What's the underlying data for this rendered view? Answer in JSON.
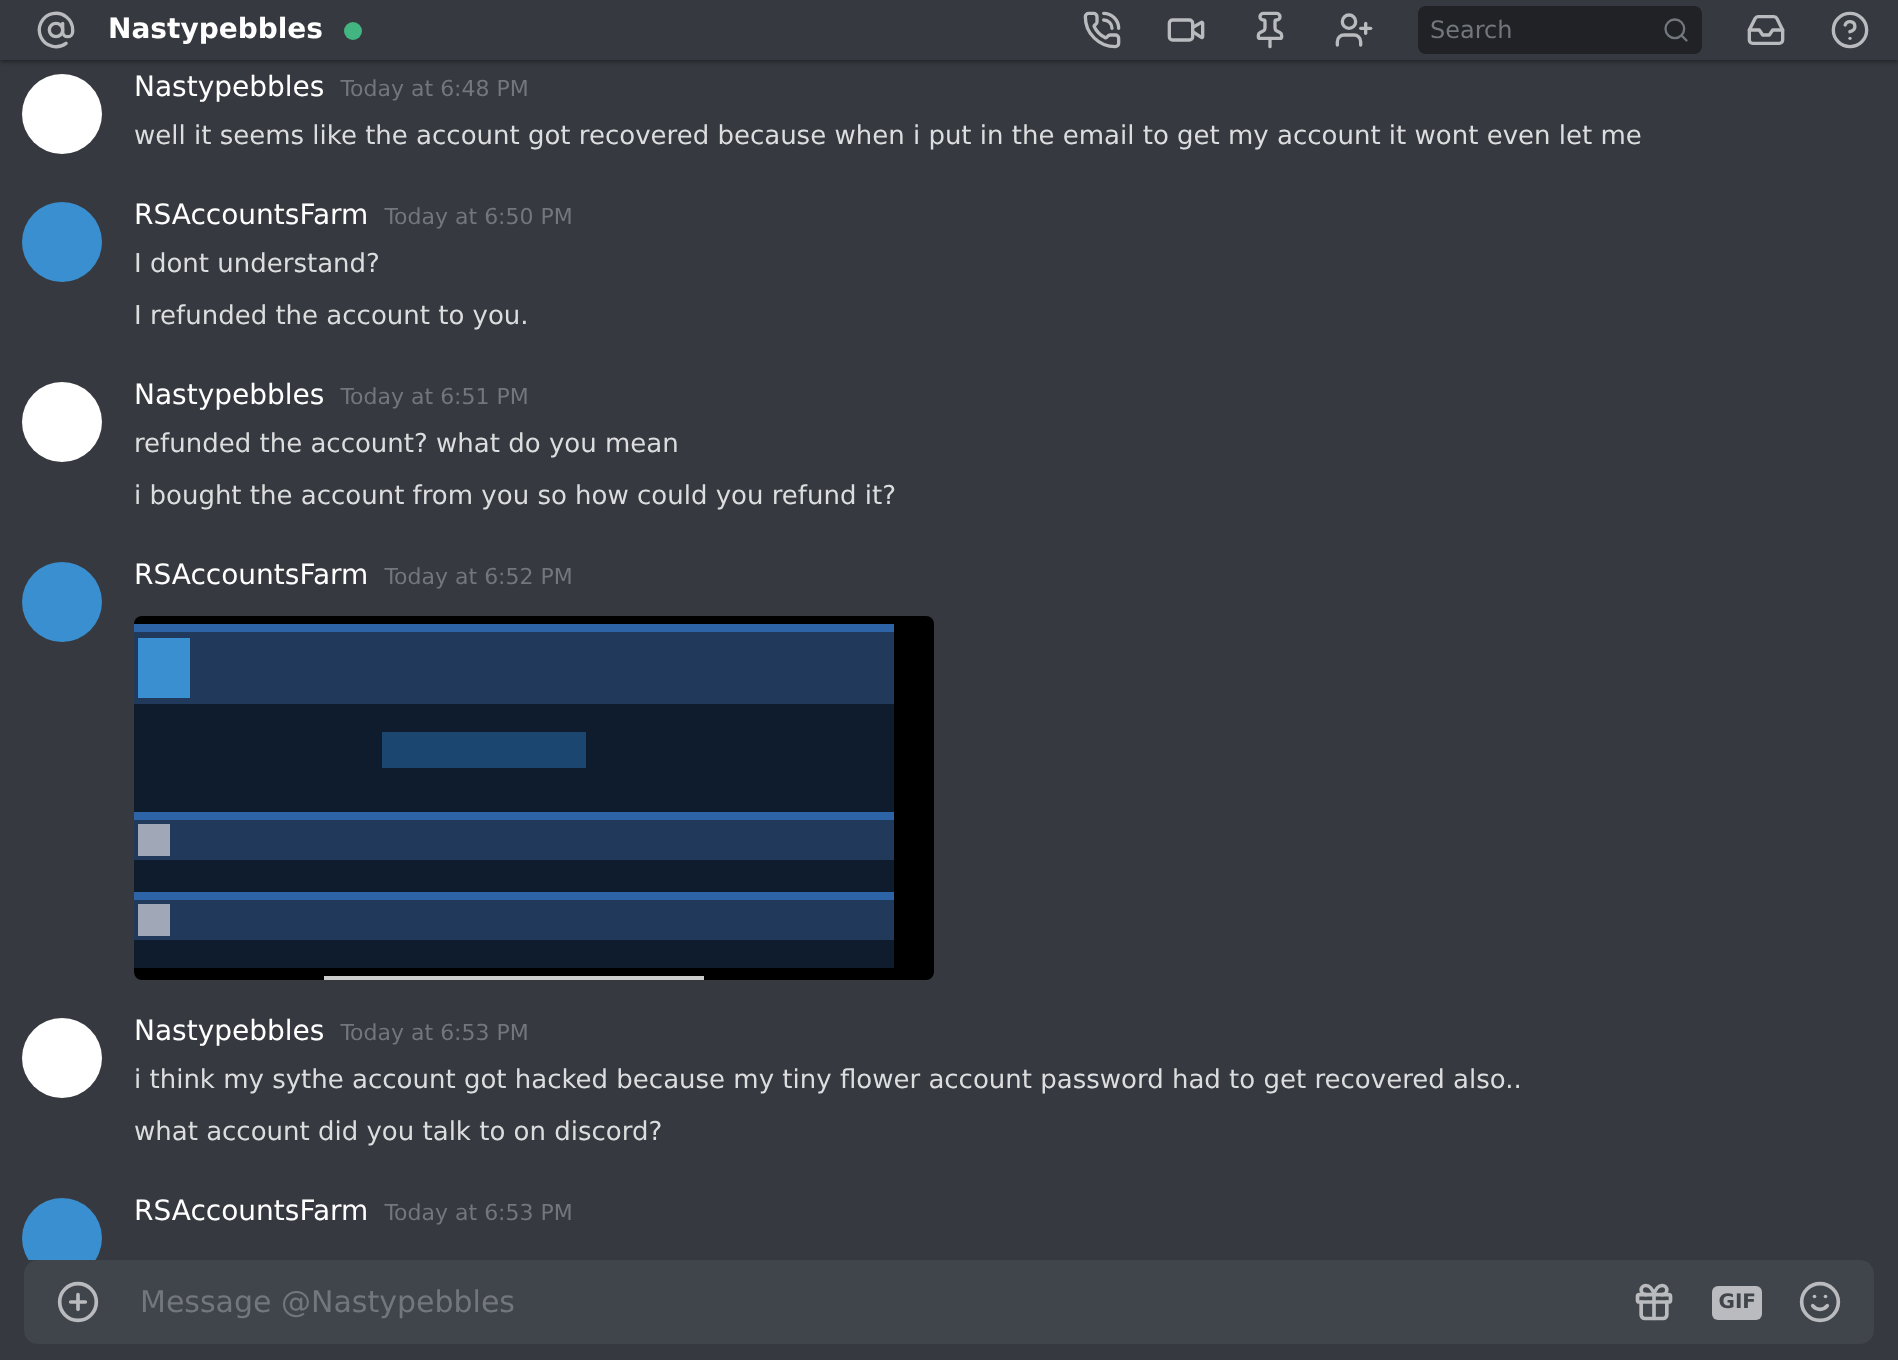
{
  "header": {
    "channel": "Nastypebbles",
    "online": true,
    "search": {
      "placeholder": "Search"
    }
  },
  "messages": [
    {
      "author": "Nastypebbles",
      "time": "Today at 6:48 PM",
      "avatar": {
        "color": "#ffffff"
      },
      "lines": [
        "well it seems like the account got recovered because when i put in the email to get my account it wont even let me"
      ]
    },
    {
      "author": "RSAccountsFarm",
      "time": "Today at 6:50 PM",
      "avatar": {
        "color": "#3a8fd0"
      },
      "lines": [
        "I dont understand?",
        "I refunded the account to you."
      ]
    },
    {
      "author": "Nastypebbles",
      "time": "Today at 6:51 PM",
      "avatar": {
        "color": "#ffffff"
      },
      "lines": [
        "refunded the account? what do you mean",
        "i bought the account from you so how could you refund it?"
      ]
    },
    {
      "author": "RSAccountsFarm",
      "time": "Today at 6:52 PM",
      "avatar": {
        "color": "#3a8fd0"
      },
      "kind": "image"
    },
    {
      "author": "Nastypebbles",
      "time": "Today at 6:53 PM",
      "avatar": {
        "color": "#ffffff"
      },
      "lines": [
        "i think my sythe account got hacked because my tiny flower account password had to get recovered also..",
        "what account did you talk to on discord?"
      ]
    },
    {
      "author": "RSAccountsFarm",
      "time": "Today at 6:53 PM",
      "avatar": {
        "color": "#3a8fd0"
      },
      "kind": "text"
    }
  ],
  "composer": {
    "placeholder": "Message @Nastypebbles",
    "gif_label": "GIF"
  }
}
